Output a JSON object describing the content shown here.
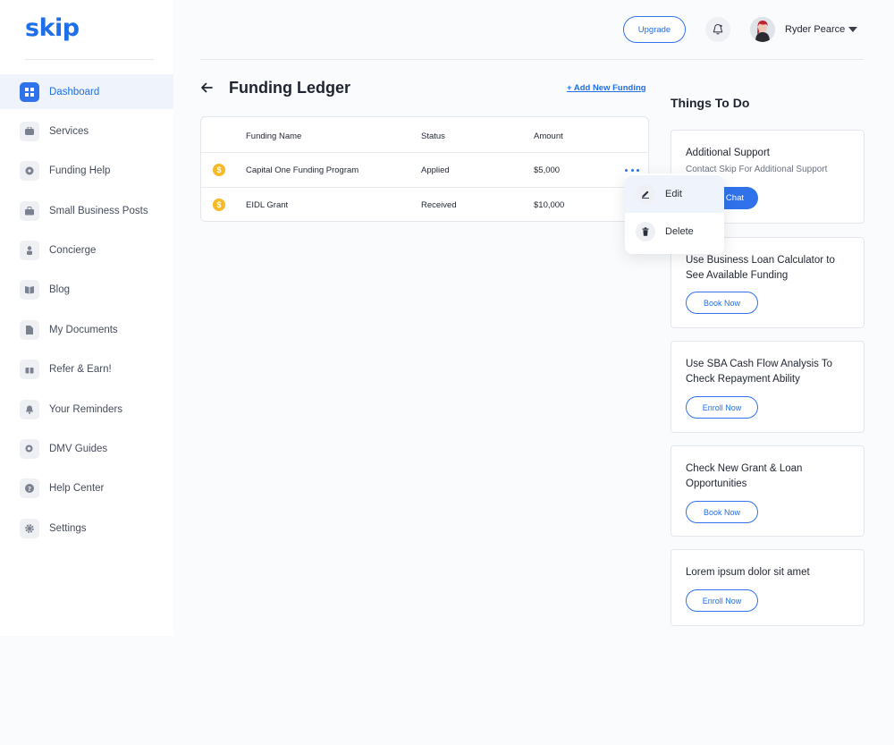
{
  "brand": {
    "logo_text": "skip",
    "accent": "#2f72ea"
  },
  "sidebar": {
    "items": [
      {
        "label": "Dashboard",
        "icon": "dashboard-icon",
        "active": true
      },
      {
        "label": "Services",
        "icon": "services-icon"
      },
      {
        "label": "Funding Help",
        "icon": "funding-help-icon"
      },
      {
        "label": "Small Business Posts",
        "icon": "briefcase-icon"
      },
      {
        "label": "Concierge",
        "icon": "concierge-icon"
      },
      {
        "label": "Blog",
        "icon": "book-icon"
      },
      {
        "label": "My Documents",
        "icon": "document-icon"
      },
      {
        "label": "Refer & Earn!",
        "icon": "gift-icon"
      },
      {
        "label": "Your Reminders",
        "icon": "bell-icon"
      },
      {
        "label": "DMV Guides",
        "icon": "search-icon"
      },
      {
        "label": "Help Center",
        "icon": "help-icon"
      },
      {
        "label": "Settings",
        "icon": "gear-icon"
      }
    ]
  },
  "header": {
    "upgrade_label": "Upgrade",
    "user_name": "Ryder Pearce"
  },
  "main": {
    "title": "Funding Ledger",
    "add_link": "+ Add New Funding",
    "table": {
      "columns": [
        "Funding Name",
        "Status",
        "Amount"
      ],
      "rows": [
        {
          "name": "Capital One Funding Program",
          "status": "Applied",
          "amount": "$5,000"
        },
        {
          "name": "EIDL Grant",
          "status": "Received",
          "amount": "$10,000"
        }
      ]
    },
    "row_menu": {
      "items": [
        {
          "label": "Edit",
          "icon": "edit-icon"
        },
        {
          "label": "Delete",
          "icon": "trash-icon"
        }
      ]
    }
  },
  "todo": {
    "title": "Things To Do",
    "cards": [
      {
        "title": "Additional Support",
        "subtitle": "Contact Skip For Additional Support",
        "button": "Chat"
      },
      {
        "title": "Use Business Loan Calculator to See Available Funding",
        "button": "Book Now"
      },
      {
        "title": "Use SBA Cash Flow Analysis To Check Repayment Ability",
        "button": "Enroll Now"
      },
      {
        "title": "Check New Grant & Loan Opportunities",
        "button": "Book Now"
      },
      {
        "title": "Lorem ipsum dolor sit amet",
        "button": "Enroll Now"
      }
    ]
  }
}
